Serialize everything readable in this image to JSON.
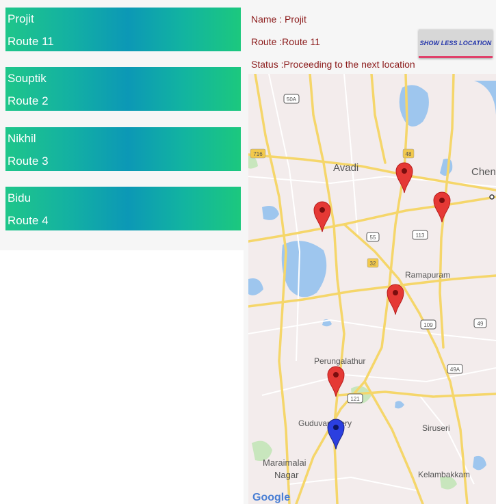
{
  "routes": [
    {
      "name": "Projit",
      "route": "Route 11"
    },
    {
      "name": "Souptik",
      "route": "Route 2"
    },
    {
      "name": "Nikhil",
      "route": "Route 3"
    },
    {
      "name": "Bidu",
      "route": "Route 4"
    }
  ],
  "detail": {
    "name": "Name : Projit",
    "route": "Route :Route 11",
    "status": "Status :Proceeding to the next location",
    "toggle_button": "SHOW LESS LOCATION"
  },
  "map": {
    "places": [
      "Avadi",
      "Chen",
      "Ramapuram",
      "Perungalathur",
      "Guduvanchery",
      "Siruseri",
      "Maraimalai",
      "Nagar",
      "Kelambakkam"
    ],
    "highway_shields": [
      "50A",
      "716",
      "48",
      "55",
      "113",
      "32",
      "109",
      "49",
      "49A",
      "121"
    ],
    "attribution": "Google",
    "marker_colors": {
      "visited": "#e53935",
      "current": "#2b3fe0"
    }
  }
}
